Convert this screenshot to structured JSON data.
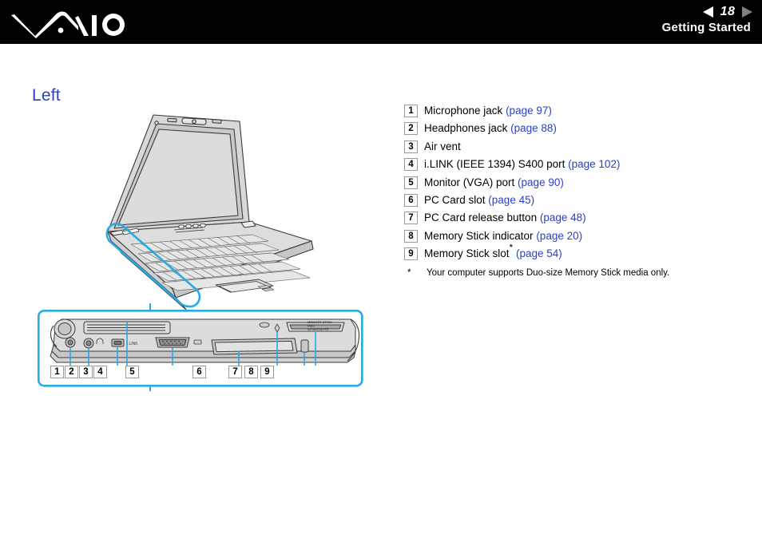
{
  "header": {
    "logo_name": "vaio-logo",
    "page_number": "18",
    "prev_arrow": "◀",
    "next_arrow": "▶",
    "section_title": "Getting Started"
  },
  "page": {
    "title": "Left"
  },
  "callouts": [
    {
      "num": "1",
      "label": "Microphone jack",
      "page_ref": "(page 97)",
      "star": false
    },
    {
      "num": "2",
      "label": "Headphones jack",
      "page_ref": "(page 88)",
      "star": false
    },
    {
      "num": "3",
      "label": "Air vent",
      "page_ref": "",
      "star": false
    },
    {
      "num": "4",
      "label": "i.LINK (IEEE 1394) S400 port",
      "page_ref": "(page 102)",
      "star": false
    },
    {
      "num": "5",
      "label": "Monitor (VGA) port",
      "page_ref": "(page 90)",
      "star": false
    },
    {
      "num": "6",
      "label": "PC Card slot",
      "page_ref": "(page 45)",
      "star": false
    },
    {
      "num": "7",
      "label": "PC Card release button",
      "page_ref": "(page 48)",
      "star": false
    },
    {
      "num": "8",
      "label": "Memory Stick indicator",
      "page_ref": "(page 20)",
      "star": false
    },
    {
      "num": "9",
      "label": "Memory Stick slot",
      "page_ref": "(page 54)",
      "star": true
    }
  ],
  "footnote": {
    "mark": "*",
    "text": "Your computer supports Duo-size Memory Stick media only."
  },
  "diagram": {
    "detail_numbers": [
      "1",
      "2",
      "3",
      "4",
      "5",
      "6",
      "7",
      "8",
      "9"
    ],
    "memory_stick_logo": "MEMORY STICK PRO  MagicGate",
    "ilink_port_label": "i.LINK"
  },
  "colors": {
    "accent_blue": "#2b3fc4",
    "highlight_cyan": "#29abe2",
    "header_bg": "#000000",
    "line_art": "#3a3a3a",
    "panel_fill": "#d4d4d4"
  }
}
